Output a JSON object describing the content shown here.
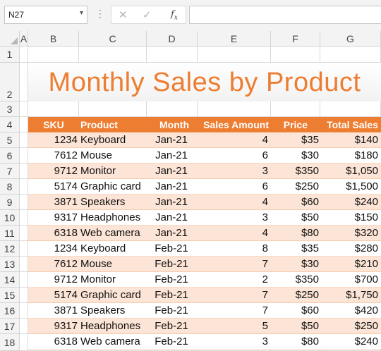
{
  "formula_bar": {
    "name_box": "N27",
    "dropdown_icon": "chevron-down-icon",
    "cancel_icon": "cancel-x-icon",
    "enter_icon": "checkmark-icon",
    "function_icon": "fx-icon",
    "formula": ""
  },
  "columns": [
    "A",
    "B",
    "C",
    "D",
    "E",
    "F",
    "G"
  ],
  "rows": [
    "1",
    "2",
    "3",
    "4",
    "5",
    "6",
    "7",
    "8",
    "9",
    "10",
    "11",
    "12",
    "13",
    "14",
    "15",
    "16",
    "17",
    "18"
  ],
  "title": "Monthly Sales by Product",
  "table": {
    "headers": [
      "SKU",
      "Product",
      "Month",
      "Sales Amount",
      "Price",
      "Total Sales"
    ],
    "rows": [
      [
        "1234",
        "Keyboard",
        "Jan-21",
        "4",
        "$35",
        "$140"
      ],
      [
        "7612",
        "Mouse",
        "Jan-21",
        "6",
        "$30",
        "$180"
      ],
      [
        "9712",
        "Monitor",
        "Jan-21",
        "3",
        "$350",
        "$1,050"
      ],
      [
        "5174",
        "Graphic card",
        "Jan-21",
        "6",
        "$250",
        "$1,500"
      ],
      [
        "3871",
        "Speakers",
        "Jan-21",
        "4",
        "$60",
        "$240"
      ],
      [
        "9317",
        "Headphones",
        "Jan-21",
        "3",
        "$50",
        "$150"
      ],
      [
        "6318",
        "Web camera",
        "Jan-21",
        "4",
        "$80",
        "$320"
      ],
      [
        "1234",
        "Keyboard",
        "Feb-21",
        "8",
        "$35",
        "$280"
      ],
      [
        "7612",
        "Mouse",
        "Feb-21",
        "7",
        "$30",
        "$210"
      ],
      [
        "9712",
        "Monitor",
        "Feb-21",
        "2",
        "$350",
        "$700"
      ],
      [
        "5174",
        "Graphic card",
        "Feb-21",
        "7",
        "$250",
        "$1,750"
      ],
      [
        "3871",
        "Speakers",
        "Feb-21",
        "7",
        "$60",
        "$420"
      ],
      [
        "9317",
        "Headphones",
        "Feb-21",
        "5",
        "$50",
        "$250"
      ],
      [
        "6318",
        "Web camera",
        "Feb-21",
        "3",
        "$80",
        "$240"
      ]
    ]
  },
  "colors": {
    "accent": "#ed7d31",
    "band_light": "#fce4d6",
    "band_white": "#ffffff",
    "gridline": "#d9d9d9"
  }
}
